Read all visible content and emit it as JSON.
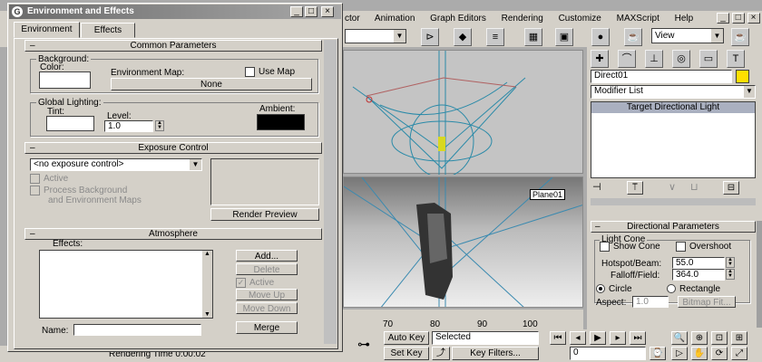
{
  "menubar": {
    "items": [
      "ctor",
      "Animation",
      "Graph Editors",
      "Rendering",
      "Customize",
      "MAXScript",
      "Help"
    ]
  },
  "toolbar": {
    "view_dropdown": "View"
  },
  "dialog": {
    "title": "Environment and Effects",
    "tabs": [
      "Environment",
      "Effects"
    ],
    "common": {
      "header": "Common Parameters",
      "background_group": "Background:",
      "color_label": "Color:",
      "env_map_label": "Environment Map:",
      "use_map_label": "Use Map",
      "none_button": "None",
      "global_lighting_group": "Global Lighting:",
      "tint_label": "Tint:",
      "level_label": "Level:",
      "level_value": "1.0",
      "ambient_label": "Ambient:"
    },
    "exposure": {
      "header": "Exposure Control",
      "select_value": "<no exposure control>",
      "active_label": "Active",
      "process_bg_label": "Process Background",
      "process_bg_label2": "and Environment Maps",
      "render_preview": "Render Preview"
    },
    "atmosphere": {
      "header": "Atmosphere",
      "effects_label": "Effects:",
      "add": "Add...",
      "delete": "Delete",
      "active": "Active",
      "move_up": "Move Up",
      "move_down": "Move Down",
      "name_label": "Name:",
      "merge": "Merge"
    },
    "colors": {
      "background_color": "#ffffff",
      "tint_color": "#ffffff",
      "ambient_color": "#000000"
    }
  },
  "viewport": {
    "object_label": "Plane01",
    "ruler_ticks": [
      "70",
      "80",
      "90",
      "100"
    ]
  },
  "bottom": {
    "auto_key": "Auto Key",
    "set_key": "Set Key",
    "selected": "Selected",
    "key_filters": "Key Filters...",
    "frame_value": "0",
    "status_text": "Rendering Time 0:00:02"
  },
  "panel": {
    "object_name": "Direct01",
    "object_color": "#ffe000",
    "modifier_list": "Modifier List",
    "stack_item": "Target Directional Light",
    "directional_header": "Directional Parameters",
    "light_cone_group": "Light Cone",
    "show_cone": "Show Cone",
    "overshoot": "Overshoot",
    "hotspot_label": "Hotspot/Beam:",
    "hotspot_value": "55.0",
    "falloff_label": "Falloff/Field:",
    "falloff_value": "364.0",
    "circle": "Circle",
    "rectangle": "Rectangle",
    "aspect_label": "Aspect:",
    "aspect_value": "1.0",
    "bitmap_fit": "Bitmap Fit..."
  }
}
